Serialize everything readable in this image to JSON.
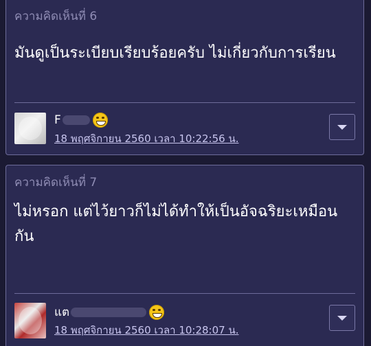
{
  "comments": [
    {
      "header": "ความคิดเห็นที่ 6",
      "body": "มันดูเป็นระเบียบเรียบร้อยครับ ไม่เกี่ยวกับการเรียน",
      "username": "F",
      "timestamp": "18 พฤศจิกายน 2560 เวลา 10:22:56 น.",
      "emoji": "laughing-face"
    },
    {
      "header": "ความคิดเห็นที่ 7",
      "body": "ไม่หรอก แต่ไว้ยาวก็ไม่ได้ทำให้เป็นอัจฉริยะเหมือนกัน",
      "username": "แต",
      "timestamp": "18 พฤศจิกายน 2560 เวลา 10:28:07 น.",
      "emoji": "laughing-face"
    }
  ],
  "colors": {
    "page_background": "#1b1a33",
    "card_background": "#2b2a52",
    "card_border": "#6e6c9a",
    "header_text": "#8f8cb4",
    "body_text": "#ffffff",
    "timestamp_text": "#c8c5ee"
  }
}
